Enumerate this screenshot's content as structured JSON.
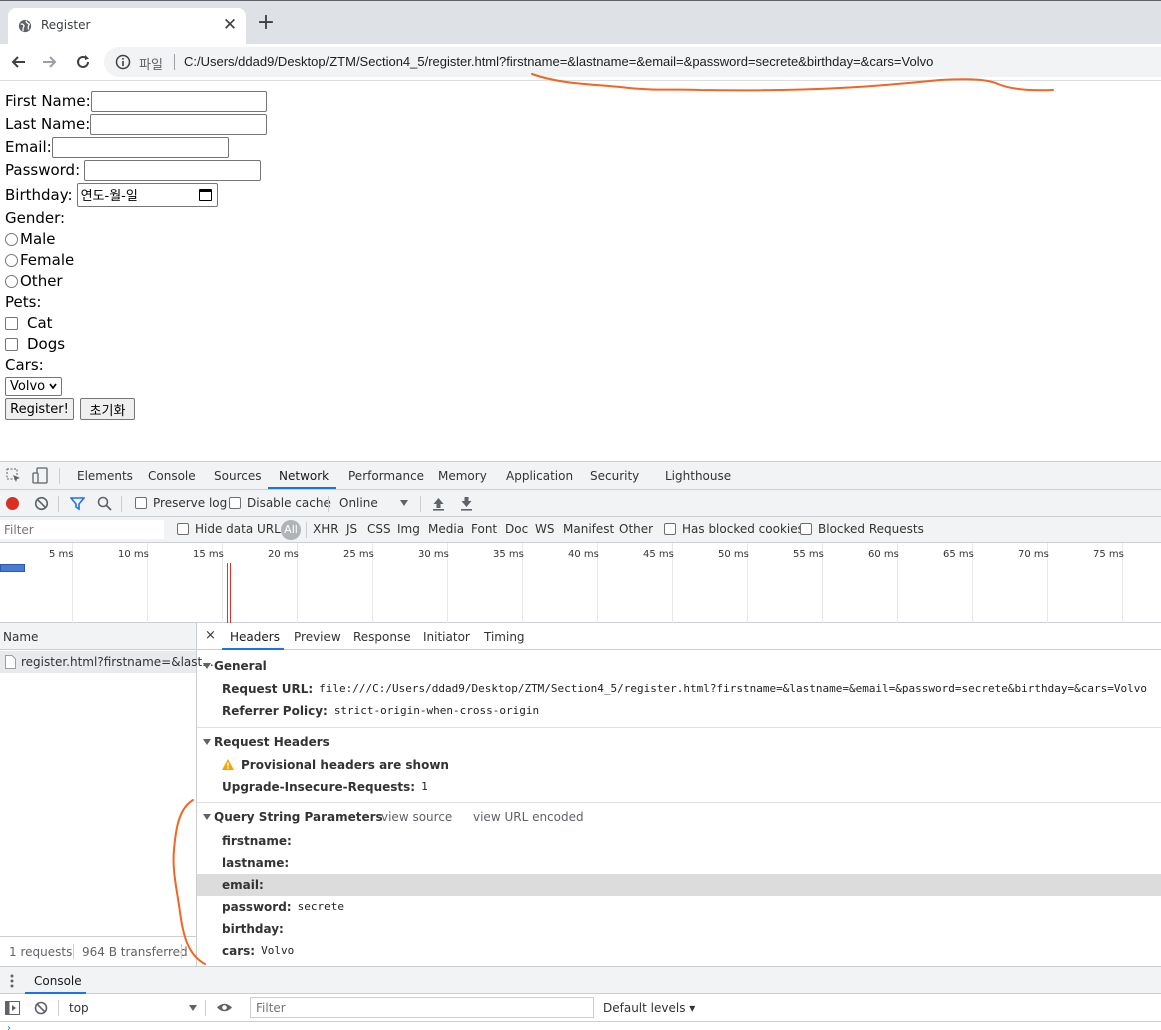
{
  "browser": {
    "tab_title": "Register",
    "close_glyph": "✕",
    "newtab_glyph": "+",
    "scheme_label": "파일",
    "url": "C:/Users/ddad9/Desktop/ZTM/Section4_5/register.html?firstname=&lastname=&email=&password=secrete&birthday=&cars=Volvo"
  },
  "form": {
    "first_name_label": "First Name:",
    "last_name_label": "Last Name:",
    "email_label": "Email:",
    "password_label": "Password:",
    "birthday_label": "Birthday:",
    "birthday_placeholder": "연도-월-일",
    "gender_label": "Gender:",
    "gender_options": [
      "Male",
      "Female",
      "Other"
    ],
    "pets_label": "Pets:",
    "pets_options": [
      "Cat",
      "Dogs"
    ],
    "cars_label": "Cars:",
    "cars_selected": "Volvo",
    "submit_label": "Register!",
    "reset_label": "초기화"
  },
  "devtools": {
    "tabs": [
      "Elements",
      "Console",
      "Sources",
      "Network",
      "Performance",
      "Memory",
      "Application",
      "Security",
      "Lighthouse"
    ],
    "active_tab": "Network",
    "preserve_log": "Preserve log",
    "disable_cache": "Disable cache",
    "throttle": "Online",
    "filter_placeholder": "Filter",
    "hide_data_urls": "Hide data URLs",
    "type_filters": [
      "All",
      "XHR",
      "JS",
      "CSS",
      "Img",
      "Media",
      "Font",
      "Doc",
      "WS",
      "Manifest",
      "Other"
    ],
    "has_blocked_cookies": "Has blocked cookies",
    "blocked_requests": "Blocked Requests",
    "timeline_ticks": [
      "5 ms",
      "10 ms",
      "15 ms",
      "20 ms",
      "25 ms",
      "30 ms",
      "35 ms",
      "40 ms",
      "45 ms",
      "50 ms",
      "55 ms",
      "60 ms",
      "65 ms",
      "70 ms",
      "75 ms"
    ],
    "name_header": "Name",
    "request_name": "register.html?firstname=&last...",
    "requests_count": "1 requests",
    "transferred": "964 B transferred",
    "detail_close": "×",
    "detail_tabs": [
      "Headers",
      "Preview",
      "Response",
      "Initiator",
      "Timing"
    ],
    "general": {
      "title": "General",
      "request_url_key": "Request URL:",
      "request_url": "file:///C:/Users/ddad9/Desktop/ZTM/Section4_5/register.html?firstname=&lastname=&email=&password=secrete&birthday=&cars=Volvo",
      "referrer_key": "Referrer Policy:",
      "referrer": "strict-origin-when-cross-origin"
    },
    "request_headers": {
      "title": "Request Headers",
      "warning": "Provisional headers are shown",
      "uir_key": "Upgrade-Insecure-Requests:",
      "uir_value": "1"
    },
    "query": {
      "title": "Query String Parameters",
      "view_source": "view source",
      "view_url_encoded": "view URL encoded",
      "params": [
        {
          "key": "firstname:",
          "value": ""
        },
        {
          "key": "lastname:",
          "value": ""
        },
        {
          "key": "email:",
          "value": ""
        },
        {
          "key": "password:",
          "value": "secrete"
        },
        {
          "key": "birthday:",
          "value": ""
        },
        {
          "key": "cars:",
          "value": "Volvo"
        }
      ]
    },
    "drawer_tab": "Console",
    "context": "top",
    "console_filter_placeholder": "Filter",
    "levels": "Default levels ▾"
  },
  "colors": {
    "annotation": "#f26522",
    "accent": "#1a73e8"
  }
}
